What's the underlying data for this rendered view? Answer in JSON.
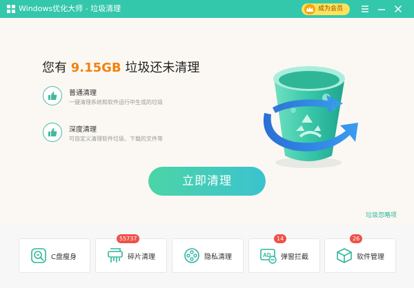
{
  "window": {
    "title": "Windows优化大师 - 垃圾清理",
    "vip_label": "成为会员"
  },
  "summary": {
    "prefix": "您有",
    "size": "9.15GB",
    "suffix": "垃圾还未清理"
  },
  "options": [
    {
      "title": "普通清理",
      "desc": "一键清理系统和软件运行中生成的垃圾",
      "icon": "thumbs-up-icon"
    },
    {
      "title": "深度清理",
      "desc": "可自定义清理软件垃圾、下载的文件等",
      "icon": "thumbs-up-icon"
    }
  ],
  "clean_button": "立即清理",
  "ignore_link": "垃圾忽略项",
  "tools": [
    {
      "label": "C盘瘦身",
      "badge": "",
      "icon": "disk-slim-icon"
    },
    {
      "label": "碎片清理",
      "badge": "55737",
      "icon": "shredder-icon"
    },
    {
      "label": "隐私清理",
      "badge": "",
      "icon": "privacy-film-icon"
    },
    {
      "label": "弹窗拦截",
      "badge": "14",
      "icon": "ad-block-icon"
    },
    {
      "label": "软件管理",
      "badge": "26",
      "icon": "software-box-icon"
    }
  ],
  "colors": {
    "accent": "#33c7ac",
    "highlight": "#f2810b",
    "badge": "#ef5147",
    "vip": "#ffe25a"
  }
}
